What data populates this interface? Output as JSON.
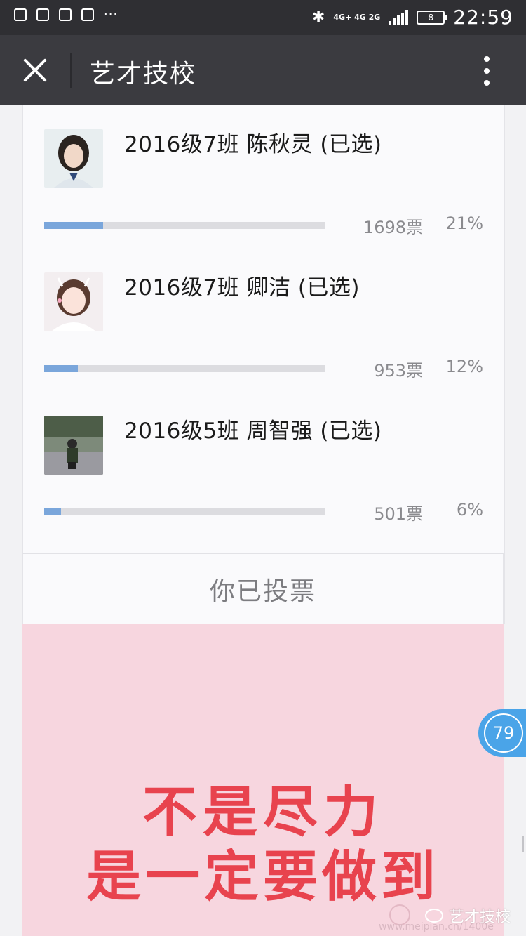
{
  "status_bar": {
    "network": "4G+ 4G 2G",
    "battery": "8",
    "time": "22:59",
    "dots": "···"
  },
  "nav": {
    "title": "艺才技校"
  },
  "poll": {
    "options": [
      {
        "label": "2016级7班 陈秋灵 (已选)",
        "votes": "1698票",
        "percent": "21%",
        "fill": 0.21
      },
      {
        "label": "2016级7班 卿洁 (已选)",
        "votes": "953票",
        "percent": "12%",
        "fill": 0.12
      },
      {
        "label": "2016级5班 周智强 (已选)",
        "votes": "501票",
        "percent": "6%",
        "fill": 0.06
      }
    ],
    "voted_text": "你已投票"
  },
  "poster": {
    "line1": "不是尽力",
    "line2": "是一定要做到"
  },
  "float_badge": "79",
  "watermark": {
    "name": "艺才技校",
    "url": "www.meipian.cn/1400e"
  },
  "colors": {
    "bar_fill": "#7aa6db",
    "bar_track": "#dcdce0",
    "poster_bg": "#f7d6df",
    "poster_text": "#e8434e",
    "badge": "#4aa4e8"
  }
}
